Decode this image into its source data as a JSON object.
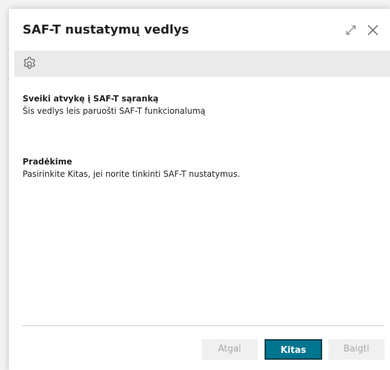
{
  "dialog": {
    "title": "SAF-T nustatymų vedlys",
    "expand_icon": "expand-icon",
    "close_icon": "close-icon"
  },
  "toolbar": {
    "icon": "gear-icon"
  },
  "welcome": {
    "heading": "Sveiki atvykę į SAF-T sąranką",
    "text": "Šis vedlys leis paruošti SAF-T funkcionalumą"
  },
  "start": {
    "heading": "Pradėkime",
    "text": "Pasirinkite Kitas, jei norite tinkinti SAF-T nustatymus."
  },
  "buttons": {
    "back": "Atgal",
    "next": "Kitas",
    "finish": "Baigti"
  },
  "colors": {
    "primary": "#00758f",
    "toolbar_bg": "#eaeaea",
    "disabled_text": "#a8a8a8"
  }
}
